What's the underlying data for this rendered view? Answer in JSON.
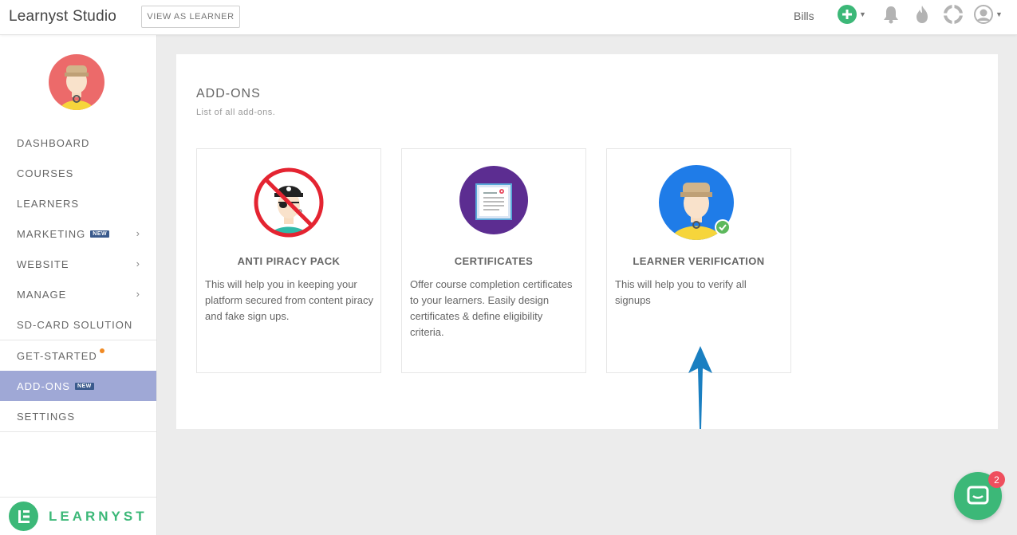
{
  "header": {
    "brand": "Learnyst Studio",
    "view_as_learner": "VIEW AS LEARNER",
    "bills": "Bills",
    "icons": [
      "plus-circle-icon",
      "bell-icon",
      "fire-icon",
      "lifebuoy-icon",
      "user-icon"
    ]
  },
  "sidebar": {
    "items": [
      {
        "label": "DASHBOARD"
      },
      {
        "label": "COURSES"
      },
      {
        "label": "LEARNERS"
      },
      {
        "label": "MARKETING",
        "badge": "NEW"
      },
      {
        "label": "WEBSITE"
      },
      {
        "label": "MANAGE"
      },
      {
        "label": "SD-CARD SOLUTION"
      },
      {
        "label": "GET-STARTED"
      },
      {
        "label": "ADD-ONS",
        "badge": "NEW"
      },
      {
        "label": "SETTINGS"
      }
    ],
    "footer": "LEARNYST"
  },
  "main": {
    "title": "ADD-ONS",
    "subtitle": "List of all add-ons.",
    "addons": [
      {
        "name": "ANTI PIRACY PACK",
        "desc": "This will help you in keeping your platform secured from content piracy and fake sign ups."
      },
      {
        "name": "CERTIFICATES",
        "desc": "Offer course completion certificates to your learners. Easily design certificates & define eligibility criteria."
      },
      {
        "name": "LEARNER VERIFICATION",
        "desc": "This will help you to verify all signups"
      }
    ]
  },
  "chat": {
    "unread": "2"
  },
  "colors": {
    "accent_green": "#3cb878",
    "active_nav": "#9fa8d6",
    "badge_blue": "#3a5a8c",
    "arrow_blue": "#1a7fc1"
  }
}
